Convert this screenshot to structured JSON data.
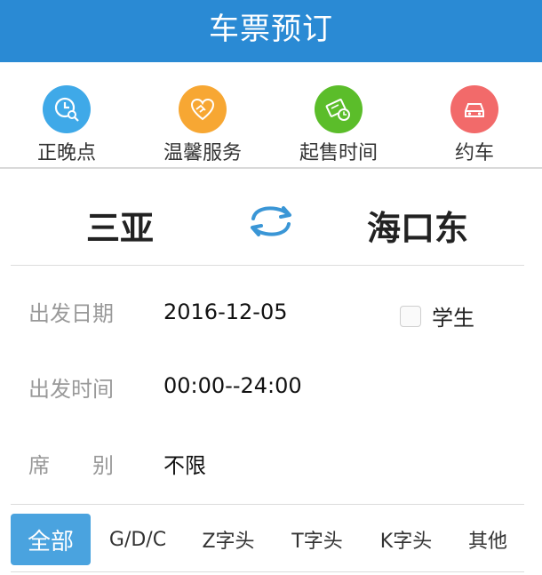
{
  "header": {
    "title": "车票预订"
  },
  "quick_actions": [
    {
      "label": "正晚点",
      "icon": "clock-search-icon",
      "color": "#3fa9e8"
    },
    {
      "label": "温馨服务",
      "icon": "handshake-heart-icon",
      "color": "#f7a733"
    },
    {
      "label": "起售时间",
      "icon": "ticket-clock-icon",
      "color": "#5bbd2a"
    },
    {
      "label": "约车",
      "icon": "car-icon",
      "color": "#f26a6a"
    }
  ],
  "stations": {
    "from": "三亚",
    "to": "海口东",
    "swap_icon": "swap-arrows-icon"
  },
  "departure_date": {
    "label": "出发日期",
    "value": "2016-12-05"
  },
  "student": {
    "label": "学生",
    "checked": false
  },
  "departure_time": {
    "label": "出发时间",
    "value": "00:00--24:00"
  },
  "seat": {
    "label": "席　　别",
    "value": "不限"
  },
  "filters": [
    {
      "label": "全部",
      "active": true
    },
    {
      "label": "G/D/C",
      "active": false
    },
    {
      "label": "Z字头",
      "active": false
    },
    {
      "label": "T字头",
      "active": false
    },
    {
      "label": "K字头",
      "active": false
    },
    {
      "label": "其他",
      "active": false
    }
  ],
  "colors": {
    "header": "#2a8ad4",
    "active_filter": "#4aa3df",
    "swap": "#3a96d6"
  }
}
